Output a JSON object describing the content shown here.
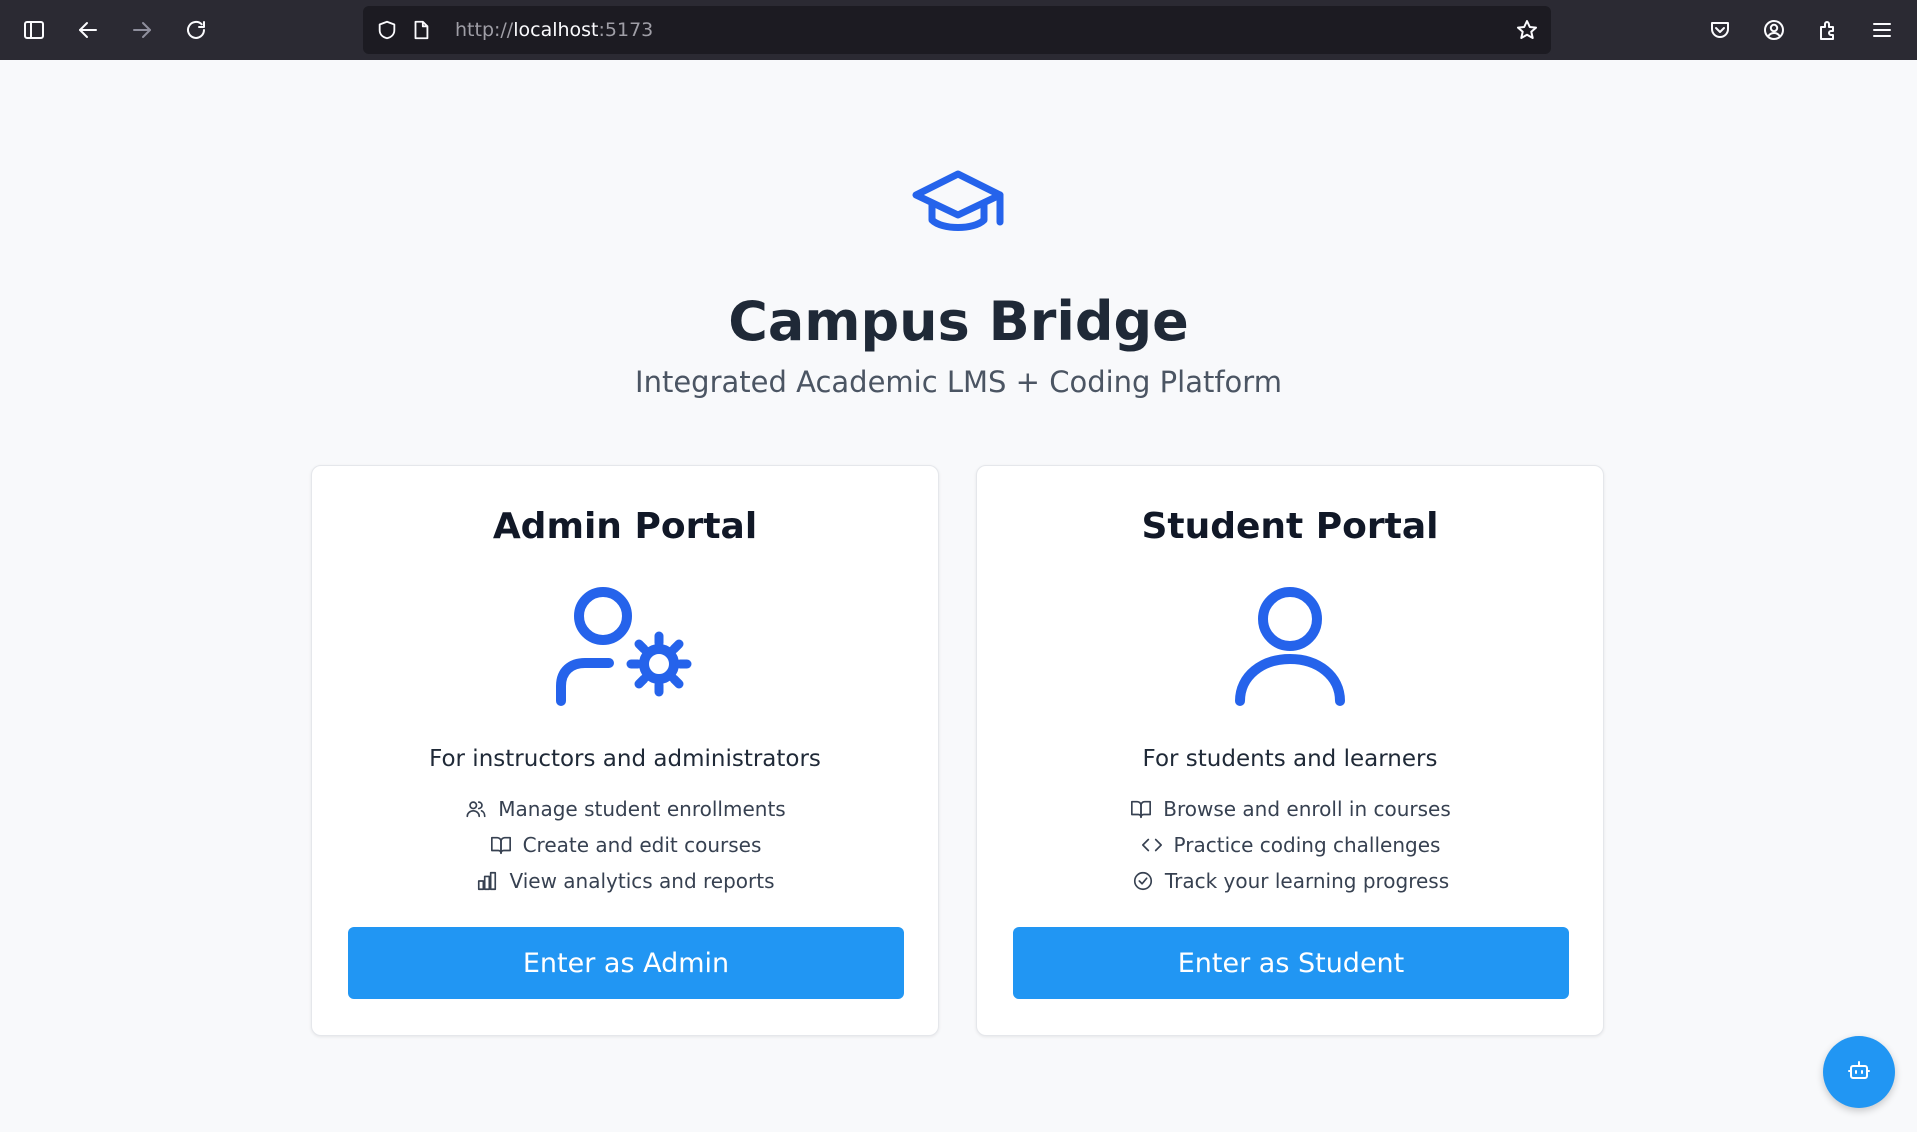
{
  "browser": {
    "url_scheme": "http://",
    "url_host": "localhost",
    "url_port": ":5173"
  },
  "colors": {
    "accent": "#2563eb",
    "button": "#2196f3"
  },
  "hero": {
    "icon": "graduation-cap-icon",
    "title": "Campus Bridge",
    "subtitle": "Integrated Academic LMS + Coding Platform"
  },
  "admin": {
    "title": "Admin Portal",
    "icon": "user-cog-icon",
    "description": "For instructors and administrators",
    "features": [
      {
        "icon": "users-icon",
        "label": "Manage student enrollments"
      },
      {
        "icon": "book-open-icon",
        "label": "Create and edit courses"
      },
      {
        "icon": "bar-chart-icon",
        "label": "View analytics and reports"
      }
    ],
    "button": "Enter as Admin"
  },
  "student": {
    "title": "Student Portal",
    "icon": "user-icon",
    "description": "For students and learners",
    "features": [
      {
        "icon": "book-open-icon",
        "label": "Browse and enroll in courses"
      },
      {
        "icon": "code-icon",
        "label": "Practice coding challenges"
      },
      {
        "icon": "check-circle-icon",
        "label": "Track your learning progress"
      }
    ],
    "button": "Enter as Student"
  },
  "fab": {
    "icon": "bot-icon"
  }
}
